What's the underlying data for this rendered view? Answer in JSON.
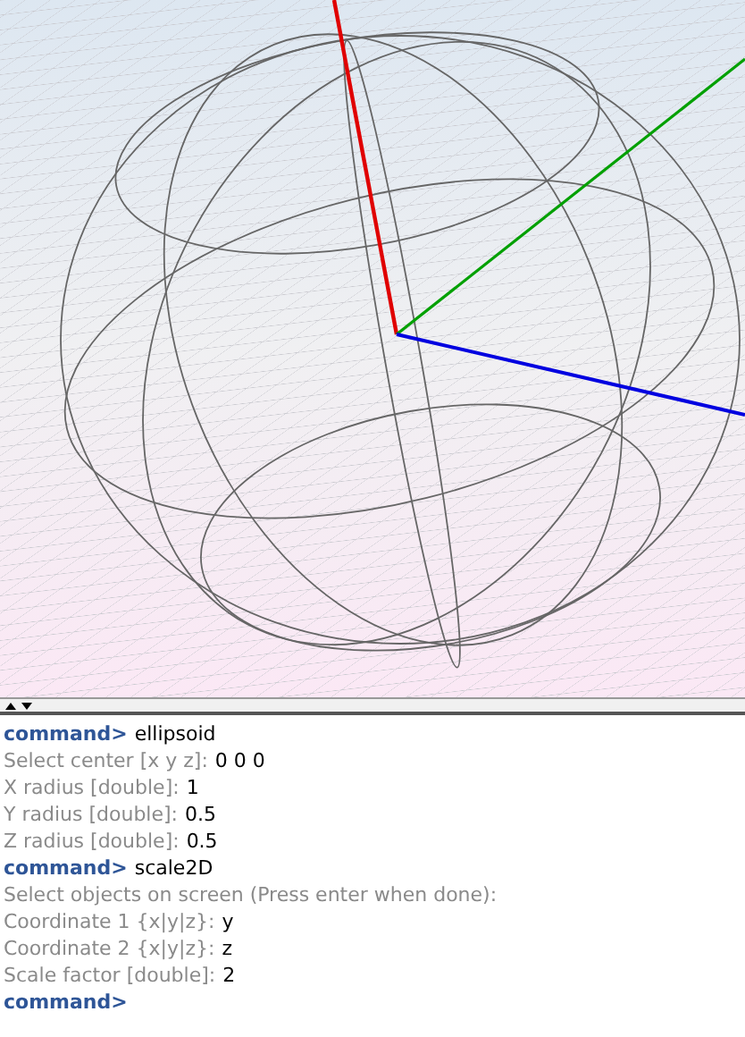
{
  "console": {
    "lines": [
      {
        "kind": "command",
        "prompt": "command>",
        "input": "ellipsoid"
      },
      {
        "kind": "query",
        "prompt": "Select center [x y z]:",
        "input": "0 0 0"
      },
      {
        "kind": "query",
        "prompt": "X radius [double]:",
        "input": "1"
      },
      {
        "kind": "query",
        "prompt": "Y radius [double]:",
        "input": "0.5"
      },
      {
        "kind": "query",
        "prompt": "Z radius [double]:",
        "input": "0.5"
      },
      {
        "kind": "command",
        "prompt": "command>",
        "input": "scale2D"
      },
      {
        "kind": "query",
        "prompt": "Select objects on screen (Press enter when done):"
      },
      {
        "kind": "query",
        "prompt": "Coordinate 1 {x|y|z}:",
        "input": "y"
      },
      {
        "kind": "query",
        "prompt": "Coordinate 2 {x|y|z}:",
        "input": "z"
      },
      {
        "kind": "query",
        "prompt": "Scale factor [double]:",
        "input": "2"
      },
      {
        "kind": "command",
        "prompt": "command>"
      }
    ]
  }
}
